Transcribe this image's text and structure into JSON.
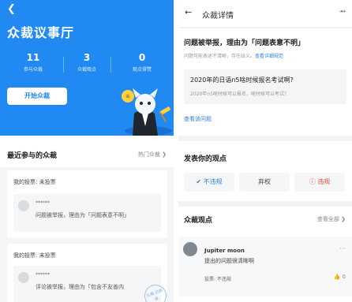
{
  "left": {
    "title": "众裁议事厅",
    "stats": [
      {
        "value": "11",
        "label": "参与众裁"
      },
      {
        "value": "3",
        "label": "众裁观点"
      },
      {
        "value": "0",
        "label": "观点得赞"
      }
    ],
    "start_button": "开始众裁",
    "recent_title": "最近参与的众裁",
    "hot_link": "热门众裁",
    "cards": [
      {
        "vote": "我的投票: 未投票",
        "user": "******",
        "reason": "问题被举报，理由为「问题表意不明」"
      },
      {
        "vote": "我的投票: 未投票",
        "user": "******",
        "reason": "评论被举报，理由为「包含不友善内",
        "stamp": "众裁 已结束"
      }
    ]
  },
  "right": {
    "nav_title": "众裁详情",
    "report_title": "问题被举报，理由为「问题表意不明」",
    "report_sub": "问题可能表述不清晰，存在歧义。",
    "report_sub_link": "查看详细规范",
    "question": "2020年的日语n5啥时候报名考试啊?",
    "question_desc": "2020年n5啥时候可以报名，啥时候可以考试?",
    "view_question": "查看该问题",
    "opinion_title": "发表你的观点",
    "options": [
      "不违规",
      "弃权",
      "违规"
    ],
    "views_title": "众裁观点",
    "views_more": "查看全部",
    "comment": {
      "name": "Jupiter moon",
      "text": "提出的问题很清晰啊",
      "vote": "投票: 不违规",
      "likes": "0"
    }
  },
  "colors": {
    "primary": "#2189f2",
    "danger": "#e24d3b"
  }
}
